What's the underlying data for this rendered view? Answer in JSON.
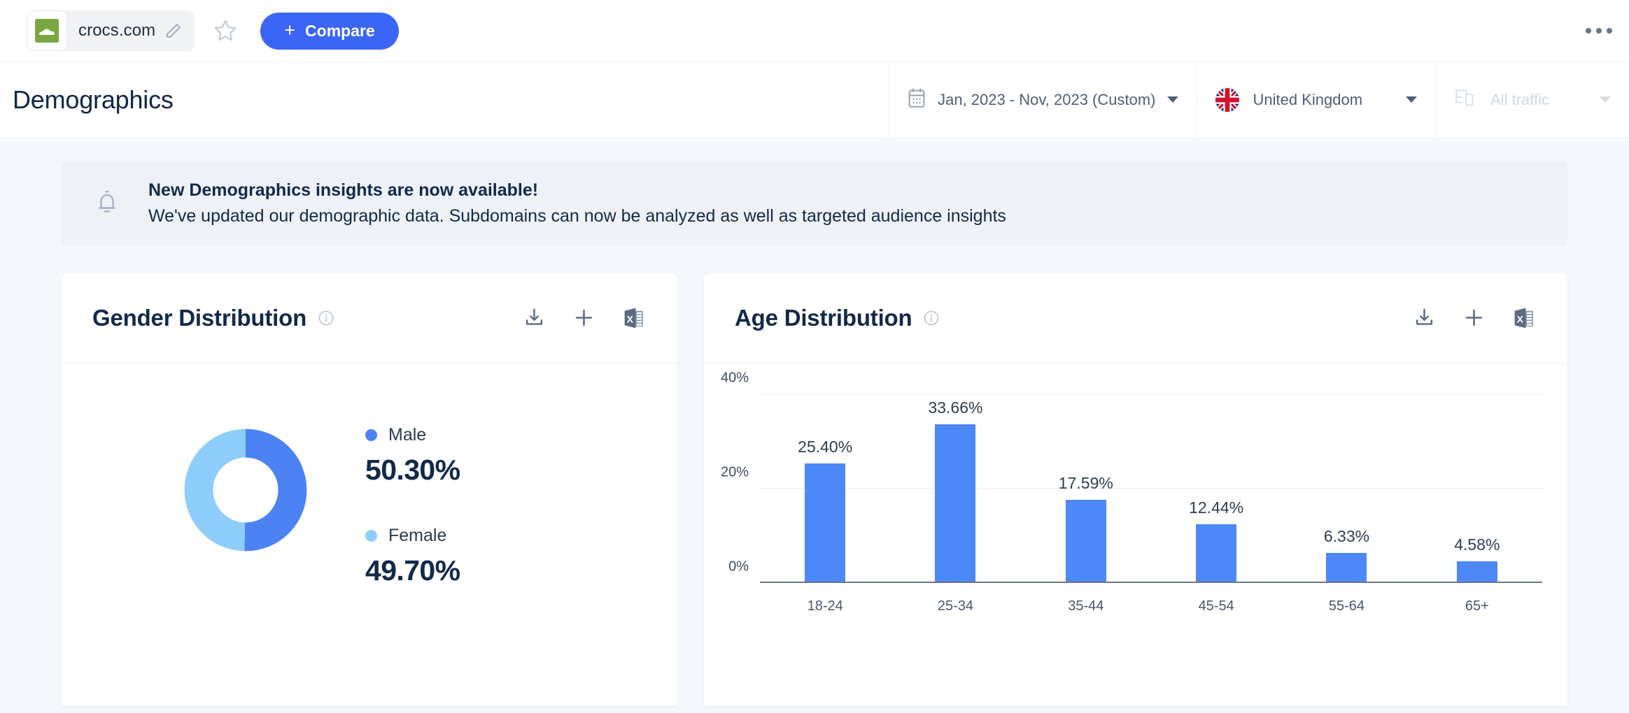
{
  "topbar": {
    "domain": "crocs.com",
    "logo_icon": "crocs-shoe-logo",
    "logo_color": "#7aa73f",
    "edit_icon": "pencil-icon",
    "favorite_icon": "star-icon",
    "compare_label": "Compare",
    "compare_plus": "+",
    "compare_color": "#3b65f5",
    "overflow_icon": "kebab-menu-icon"
  },
  "header": {
    "title": "Demographics",
    "date_filter": {
      "icon": "calendar-icon",
      "label": "Jan, 2023 - Nov, 2023 (Custom)"
    },
    "country_filter": {
      "icon": "uk-flag-icon",
      "label": "United Kingdom"
    },
    "traffic_filter": {
      "icon": "devices-icon",
      "label": "All traffic",
      "disabled": true
    }
  },
  "banner": {
    "icon": "bell-icon",
    "title": "New Demographics insights are now available!",
    "subtitle": "We've updated our demographic data. Subdomains can now be analyzed as well as targeted audience insights"
  },
  "cards": {
    "gender": {
      "title": "Gender Distribution",
      "info_icon": "info-icon",
      "actions": [
        {
          "name": "export-image-icon",
          "label": "Export"
        },
        {
          "name": "add-to-report-icon",
          "label": "Add"
        },
        {
          "name": "export-excel-icon",
          "label": "Excel"
        }
      ]
    },
    "age": {
      "title": "Age Distribution",
      "info_icon": "info-icon",
      "actions": [
        {
          "name": "export-image-icon",
          "label": "Export"
        },
        {
          "name": "add-to-report-icon",
          "label": "Add"
        },
        {
          "name": "export-excel-icon",
          "label": "Excel"
        }
      ]
    }
  },
  "chart_data": [
    {
      "type": "pie",
      "title": "Gender Distribution",
      "donut": true,
      "labels": [
        "Male",
        "Female"
      ],
      "values": [
        50.3,
        49.7
      ],
      "value_labels": [
        "50.30%",
        "49.70%"
      ],
      "colors": [
        "#4d82f3",
        "#8ecdfb"
      ],
      "legend": "right"
    },
    {
      "type": "bar",
      "title": "Age Distribution",
      "categories": [
        "18-24",
        "25-34",
        "35-44",
        "45-54",
        "55-64",
        "65+"
      ],
      "values": [
        25.4,
        33.66,
        17.59,
        12.44,
        6.33,
        4.58
      ],
      "value_labels": [
        "25.40%",
        "33.66%",
        "17.59%",
        "12.44%",
        "6.33%",
        "4.58%"
      ],
      "ylabel": "",
      "xlabel": "",
      "ylim": [
        0,
        40
      ],
      "yticks": [
        0,
        20,
        40
      ],
      "ytick_labels": [
        "0%",
        "20%",
        "40%"
      ],
      "grid": true,
      "bar_color": "#4d88f7"
    }
  ]
}
